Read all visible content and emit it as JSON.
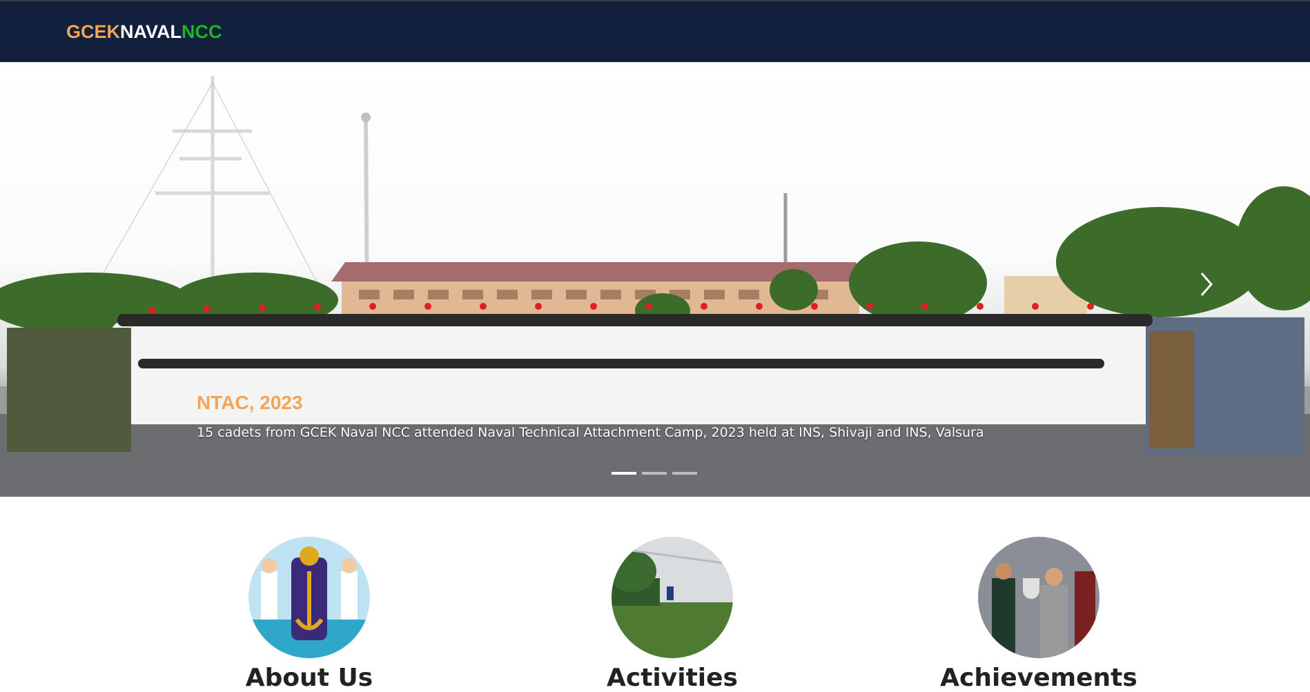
{
  "navbar": {
    "brand_part1": "GCEK",
    "brand_part2": "NAVAL",
    "brand_part3": "NCC"
  },
  "carousel": {
    "slides": [
      {
        "title": "NTAC, 2023",
        "text": "15 cadets from GCEK Naval NCC attended Naval Technical Attachment Camp, 2023 held at INS, Shivaji and INS, Valsura"
      }
    ],
    "active_index": 0,
    "indicator_count": 3,
    "next_icon": "chevron-right-icon"
  },
  "cards": [
    {
      "title": "About Us",
      "image": "navy-emblem-cartoon"
    },
    {
      "title": "Activities",
      "image": "football-field-photo"
    },
    {
      "title": "Achievements",
      "image": "trophy-presentation-photo"
    }
  ],
  "colors": {
    "navbar_bg": "#121f3d",
    "brand_orange": "#f4a452",
    "brand_green": "#22b422",
    "caption_title": "#f4a452"
  }
}
